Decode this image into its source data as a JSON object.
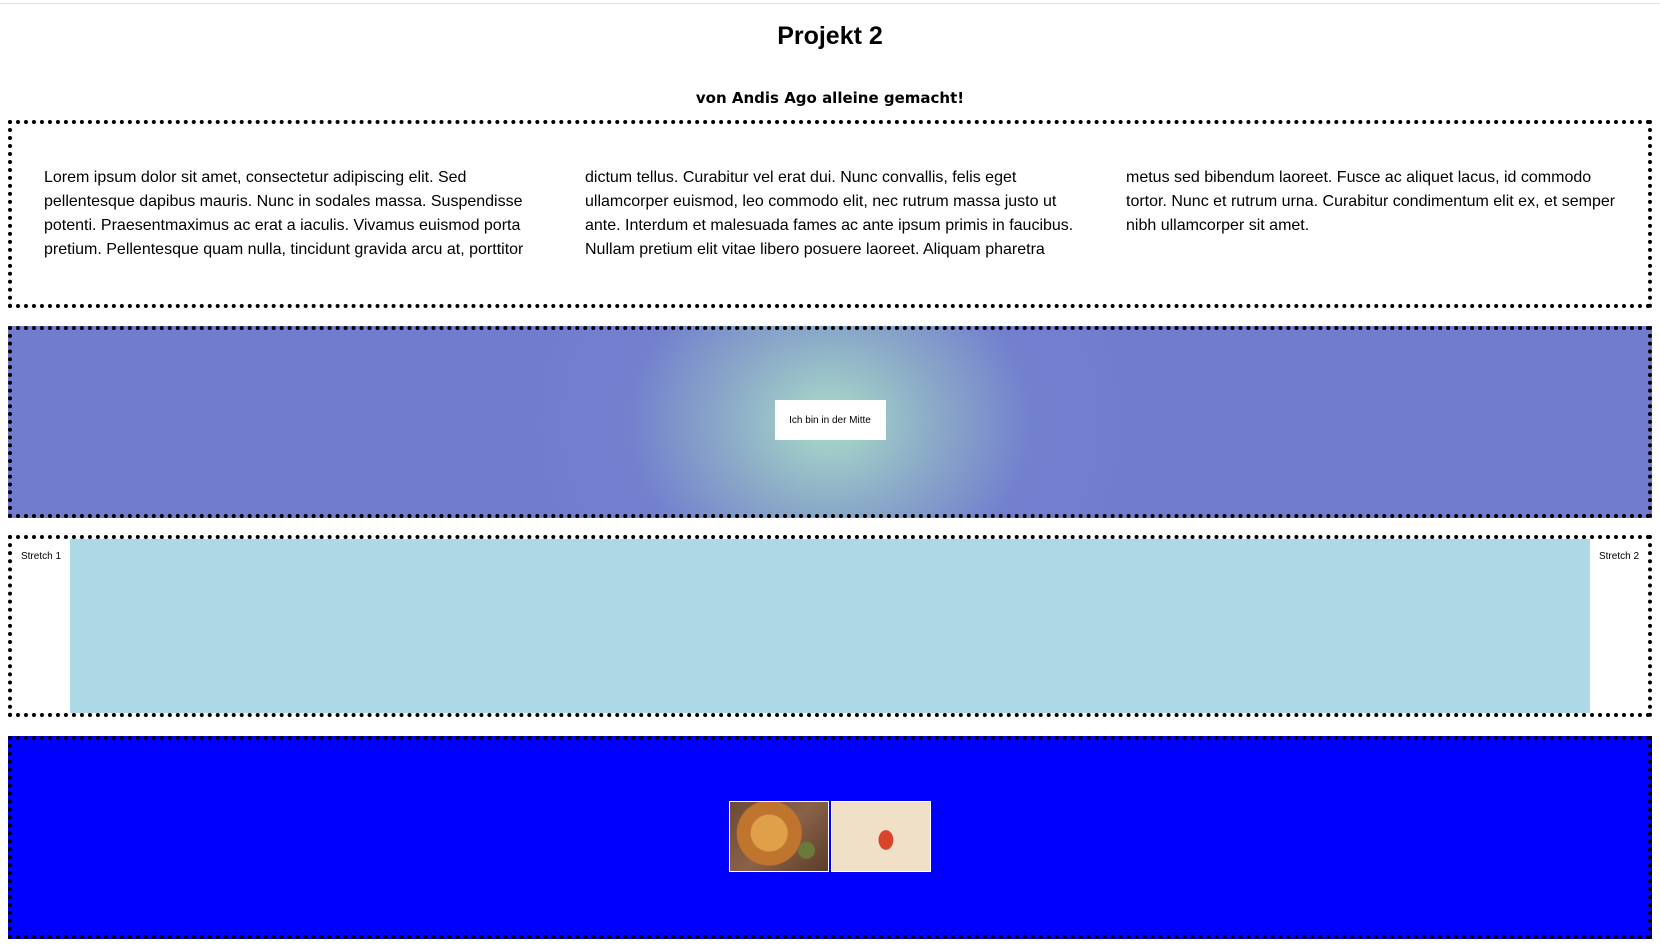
{
  "header": {
    "title": "Projekt 2",
    "subtitle": "von Andis Ago alleine gemacht!"
  },
  "text_section": {
    "paragraph": "Lorem ipsum dolor sit amet, consectetur adipiscing elit. Sed pellentesque dapibus mauris. Nunc in sodales massa. Suspendisse potenti. Praesentmaximus ac erat a iaculis. Vivamus euismod porta pretium. Pellentesque quam nulla, tincidunt gravida arcu at, porttitor dictum tellus. Curabitur vel erat dui. Nunc convallis, felis eget ullamcorper euismod, leo commodo elit, nec rutrum massa justo ut ante. Interdum et malesuada fames ac ante ipsum primis in faucibus. Nullam pretium elit vitae libero posuere laoreet. Aliquam pharetra metus sed bibendum laoreet. Fusce ac aliquet lacus, id commodo tortor. Nunc et rutrum urna. Curabitur condimentum elit ex, et semper nibh ullamcorper sit amet."
  },
  "gradient_section": {
    "center_label": "Ich bin in der Mitte"
  },
  "stretch_section": {
    "left_label": "Stretch 1",
    "right_label": "Stretch 2"
  },
  "image_section": {
    "images": [
      "pizza-photo",
      "pizza-photo"
    ]
  },
  "colors": {
    "text_border": "#000000",
    "gradient_center": "#a9dcc8",
    "gradient_outer": "#717ccf",
    "stretch_fill": "#add8e6",
    "image_section_bg": "#0000ff"
  }
}
